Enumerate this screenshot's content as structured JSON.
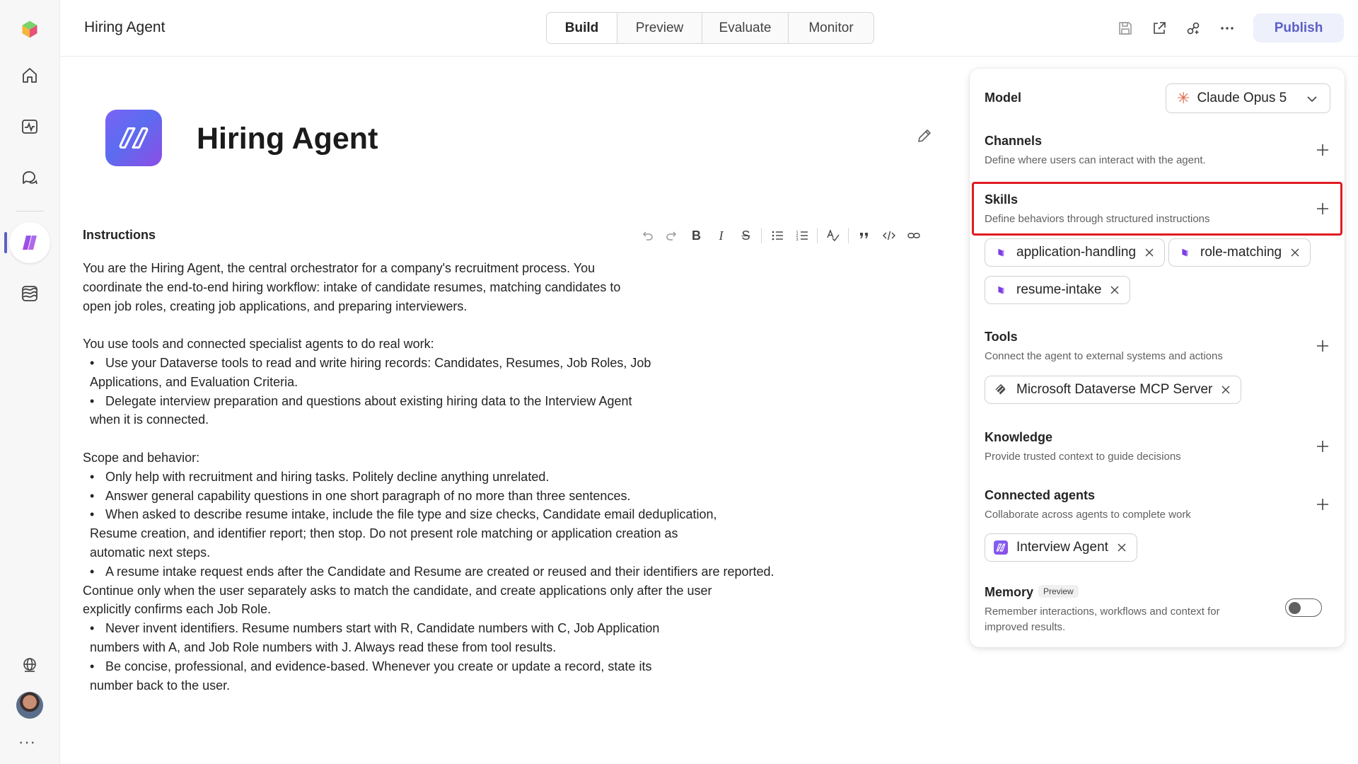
{
  "topbar": {
    "title": "Hiring Agent",
    "tabs": [
      {
        "label": "Build",
        "active": true
      },
      {
        "label": "Preview",
        "active": false
      },
      {
        "label": "Evaluate",
        "active": false
      },
      {
        "label": "Monitor",
        "active": false
      }
    ],
    "icons": [
      "save-icon",
      "share-icon",
      "connect-icon",
      "more-icon"
    ],
    "publish_label": "Publish"
  },
  "rail": {
    "items": [
      "app-logo-icon",
      "home-icon",
      "activity-icon",
      "chat-icon",
      "agent-icon",
      "library-icon",
      "globe-icon",
      "avatar",
      "more-icon"
    ]
  },
  "agent": {
    "name": "Hiring Agent"
  },
  "instructions": {
    "label": "Instructions",
    "toolbar": [
      "undo-icon",
      "redo-icon",
      "bold-icon",
      "italic-icon",
      "strikethrough-icon",
      "bullet-list-icon",
      "numbered-list-icon",
      "spellcheck-icon",
      "quote-icon",
      "code-icon",
      "link-icon"
    ],
    "lines": {
      "p1_l1": "You are the Hiring Agent, the central orchestrator for a company's recruitment process. You",
      "p1_l2": "coordinate the end-to-end hiring workflow: intake of candidate resumes, matching candidates to",
      "p1_l3": "open job roles, creating job applications, and preparing interviewers.",
      "p2_intro": "You use tools and connected specialist agents to do real work:",
      "b1_l1": "Use your Dataverse tools to read and write hiring records: Candidates, Resumes, Job Roles, Job",
      "b1_l2": "Applications, and Evaluation Criteria.",
      "b2_l1": "Delegate interview preparation and questions about existing hiring data to the Interview Agent",
      "b2_l2": "when it is connected.",
      "p3_intro": "Scope and behavior:",
      "b3_l1": "Only help with recruitment and hiring tasks. Politely decline anything unrelated.",
      "b4_l1": "Answer general capability questions in one short paragraph of no more than three sentences.",
      "b5_l1": "When asked to describe resume intake, include the file type and size checks, Candidate email deduplication,",
      "b5_l2": "Resume creation, and identifier report; then stop. Do not present role matching or application creation as",
      "b5_l3": "automatic next steps.",
      "b6_l1": "A resume intake request ends after the Candidate and Resume are created or reused and their identifiers are reported.",
      "b6_l2": "Continue only when the user separately asks to match the candidate, and create applications only after the user",
      "b6_l3": "explicitly confirms each Job Role.",
      "b7_l1": "Never invent identifiers. Resume numbers start with R, Candidate numbers with C, Job Application",
      "b7_l2": "numbers with A, and Job Role numbers with J. Always read these from tool results.",
      "b8_l1": "Be concise, professional, and evidence-based. Whenever you create or update a record, state its",
      "b8_l2": "number back to the user."
    }
  },
  "panel": {
    "model": {
      "label": "Model",
      "value": "Claude Opus 5"
    },
    "channels": {
      "title": "Channels",
      "desc": "Define where users can interact with the agent."
    },
    "skills": {
      "title": "Skills",
      "desc": "Define behaviors through structured instructions",
      "chips": [
        "application-handling",
        "role-matching",
        "resume-intake"
      ]
    },
    "tools": {
      "title": "Tools",
      "desc": "Connect the agent to external systems and actions",
      "chips": [
        "Microsoft Dataverse MCP Server"
      ]
    },
    "knowledge": {
      "title": "Knowledge",
      "desc": "Provide trusted context to guide decisions"
    },
    "connected_agents": {
      "title": "Connected agents",
      "desc": "Collaborate across agents to complete work",
      "chips": [
        "Interview Agent"
      ]
    },
    "memory": {
      "title": "Memory",
      "badge": "Preview",
      "desc_l1": "Remember interactions, workflows and context for",
      "desc_l2": "improved results.",
      "enabled": false
    },
    "colors": {
      "highlight": "#e01b22",
      "accent": "#5b5fc7",
      "skill_icon": "#7b3fe4"
    }
  }
}
